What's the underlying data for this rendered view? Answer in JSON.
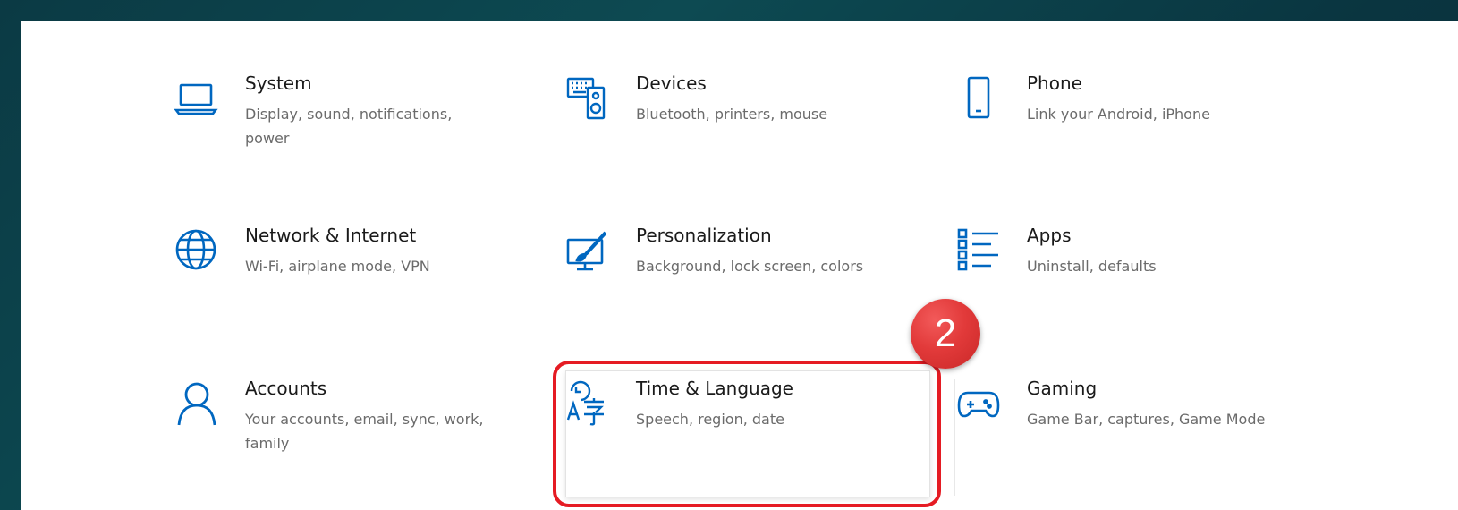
{
  "settings": {
    "tiles": [
      {
        "title": "System",
        "desc": "Display, sound, notifications, power",
        "icon": "laptop-icon"
      },
      {
        "title": "Devices",
        "desc": "Bluetooth, printers, mouse",
        "icon": "keyboard-speaker-icon"
      },
      {
        "title": "Phone",
        "desc": "Link your Android, iPhone",
        "icon": "phone-icon"
      },
      {
        "title": "Network & Internet",
        "desc": "Wi-Fi, airplane mode, VPN",
        "icon": "globe-icon"
      },
      {
        "title": "Personalization",
        "desc": "Background, lock screen, colors",
        "icon": "paint-brush-icon"
      },
      {
        "title": "Apps",
        "desc": "Uninstall, defaults",
        "icon": "apps-list-icon"
      },
      {
        "title": "Accounts",
        "desc": "Your accounts, email, sync, work, family",
        "icon": "person-icon"
      },
      {
        "title": "Time & Language",
        "desc": "Speech, region, date",
        "icon": "time-language-icon"
      },
      {
        "title": "Gaming",
        "desc": "Game Bar, captures, Game Mode",
        "icon": "gamepad-icon"
      }
    ]
  },
  "annotation": {
    "step_number": "2",
    "badge_color": "#e23a3a",
    "frame_color": "#e51b23"
  },
  "theme": {
    "accent": "#0067c0"
  }
}
